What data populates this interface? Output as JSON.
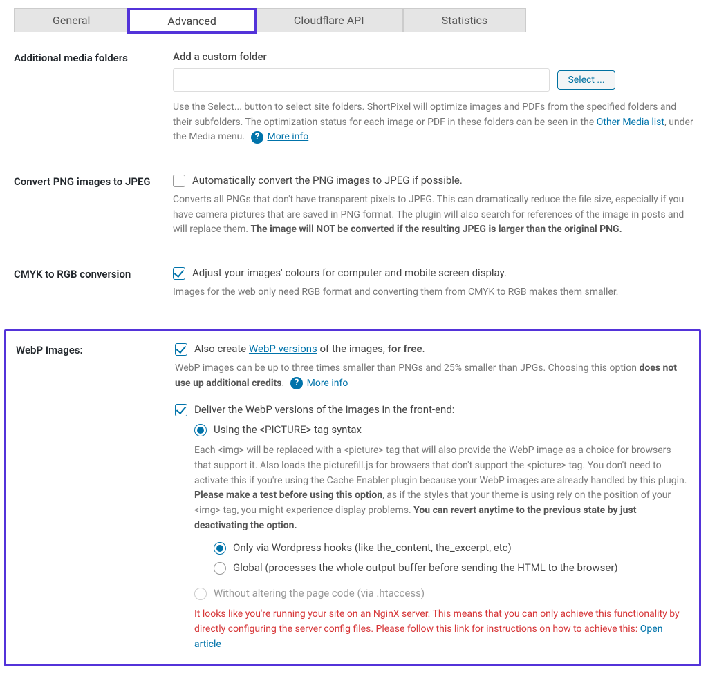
{
  "tabs": {
    "general": "General",
    "advanced": "Advanced",
    "cloudflare": "Cloudflare API",
    "statistics": "Statistics"
  },
  "rows": {
    "folders": {
      "label": "Additional media folders",
      "title": "Add a custom folder",
      "select_btn": "Select ...",
      "desc1": "Use the Select... button to select site folders. ShortPixel will optimize images and PDFs from the specified folders and their subfolders. The optimization status for each image or PDF in these folders can be seen in the ",
      "other_media": "Other Media list",
      "desc2": ", under the Media menu.",
      "more_info": "More info"
    },
    "png": {
      "label": "Convert PNG images to JPEG",
      "check_label": "Automatically convert the PNG images to JPEG if possible.",
      "desc1": "Converts all PNGs that don't have transparent pixels to JPEG. This can dramatically reduce the file size, especially if you have camera pictures that are saved in PNG format. The plugin will also search for references of the image in posts and will replace them. ",
      "desc_bold": "The image will NOT be converted if the resulting JPEG is larger than the original PNG."
    },
    "cmyk": {
      "label": "CMYK to RGB conversion",
      "check_label": "Adjust your images' colours for computer and mobile screen display.",
      "desc": "Images for the web only need RGB format and converting them from CMYK to RGB makes them smaller."
    },
    "webp": {
      "label": "WebP Images:",
      "check1_pre": "Also create ",
      "check1_link": "WebP versions",
      "check1_mid": " of the images, ",
      "check1_bold": "for free",
      "check1_post": ".",
      "desc1a": "WebP images can be up to three times smaller than PNGs and 25% smaller than JPGs. Choosing this option ",
      "desc1_bold": "does not use up additional credits",
      "desc1b": ".",
      "more_info": "More info",
      "check2": "Deliver the WebP versions of the images in the front-end:",
      "radio_picture": "Using the <PICTURE> tag syntax",
      "picture_desc1": "Each <img> will be replaced with a <picture> tag that will also provide the WebP image as a choice for browsers that support it. Also loads the picturefill.js for browsers that don't support the <picture> tag. You don't need to activate this if you're using the Cache Enabler plugin because your WebP images are already handled by this plugin. ",
      "picture_desc_bold1": "Please make a test before using this option",
      "picture_desc2": ", as if the styles that your theme is using rely on the position of your <img> tag, you might experience display problems. ",
      "picture_desc_bold2": "You can revert anytime to the previous state by just deactivating the option.",
      "radio_hooks": "Only via Wordpress hooks (like the_content, the_excerpt, etc)",
      "radio_global": "Global (processes the whole output buffer before sending the HTML to the browser)",
      "radio_htaccess": "Without altering the page code (via .htaccess)",
      "warn": "It looks like you're running your site on an NginX server. This means that you can only achieve this functionality by directly configuring the server config files. Please follow this link for instructions on how to achieve this: ",
      "warn_link": "Open article"
    }
  }
}
